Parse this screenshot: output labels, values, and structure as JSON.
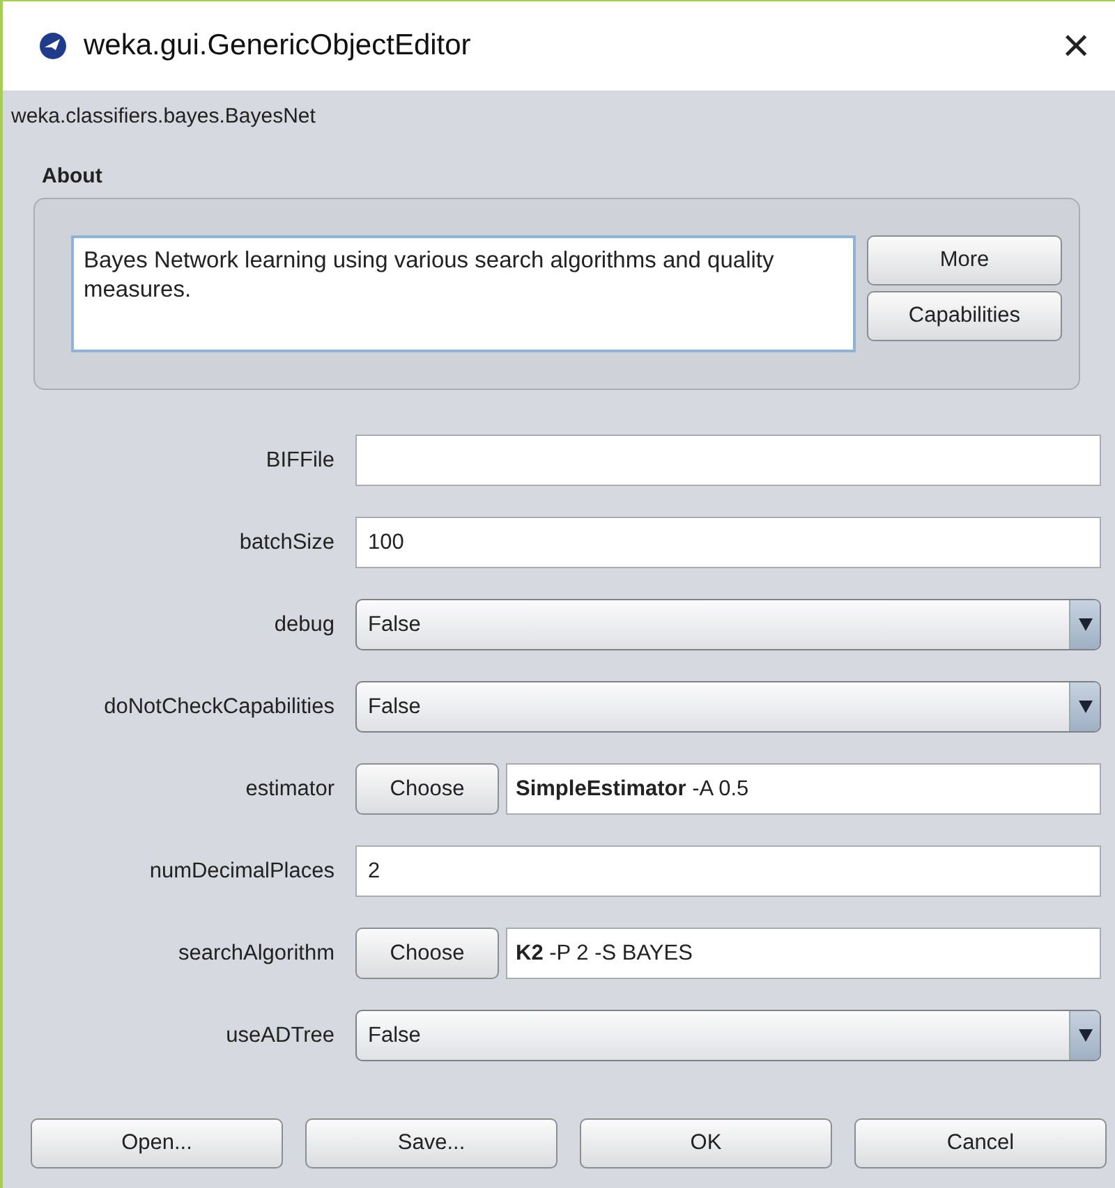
{
  "window": {
    "title": "weka.gui.GenericObjectEditor",
    "close": "×"
  },
  "class_name": "weka.classifiers.bayes.BayesNet",
  "about": {
    "heading": "About",
    "text": "Bayes Network learning using various search algorithms and quality measures.",
    "buttons": [
      "More",
      "Capabilities"
    ]
  },
  "properties": [
    {
      "label": "BIFFile",
      "kind": "text"
    },
    {
      "label": "batchSize",
      "kind": "text",
      "value": "100"
    },
    {
      "label": "debug",
      "kind": "select",
      "value": "False"
    },
    {
      "label": "doNotCheckCapabilities",
      "kind": "select",
      "value": "False"
    },
    {
      "label": "estimator",
      "kind": "choose",
      "button": "Choose",
      "value": "**SimpleEstimator** -A 0.5"
    },
    {
      "label": "numDecimalPlaces",
      "kind": "text",
      "value": "2"
    },
    {
      "label": "searchAlgorithm",
      "kind": "choose",
      "button": "Choose",
      "value": "**K2** -P 2 -S BAYES"
    },
    {
      "label": "useADTree",
      "kind": "select",
      "value": "False"
    }
  ],
  "buttons": [
    "Open...",
    "Save...",
    "OK",
    "Cancel"
  ]
}
